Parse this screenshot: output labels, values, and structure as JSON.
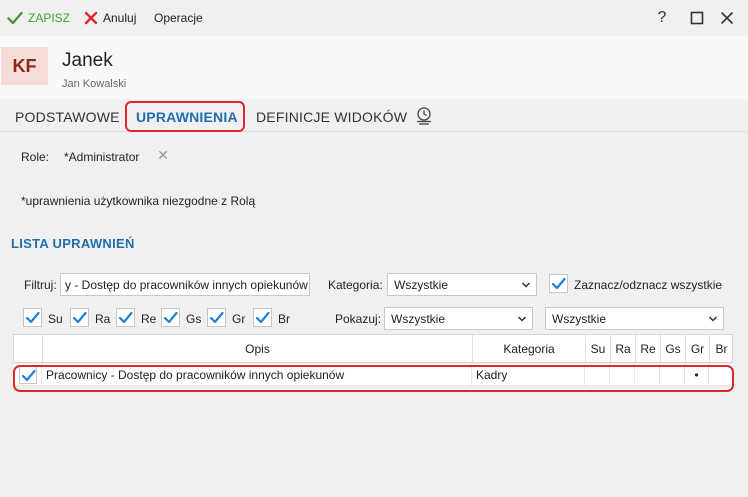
{
  "toolbar": {
    "save_label": "ZAPISZ",
    "cancel_label": "Anuluj",
    "operations_label": "Operacje",
    "help_glyph": "?",
    "save_icon": "checkmark-icon",
    "cancel_icon": "x-icon",
    "colors": {
      "save": "#4a9a3a",
      "cancel": "#e0262a"
    }
  },
  "header": {
    "avatar_initials": "KF",
    "name": "Janek",
    "subname": "Jan Kowalski"
  },
  "tabs": [
    {
      "label": "PODSTAWOWE",
      "active": false
    },
    {
      "label": "UPRAWNIENIA",
      "active": true
    },
    {
      "label": "DEFINICJE WIDOKÓW",
      "active": false
    }
  ],
  "roles": {
    "label": "Role:",
    "value": "*Administrator",
    "remove_glyph": "✕"
  },
  "note": "*uprawnienia użytkownika niezgodne z Rolą",
  "section_title": "LISTA UPRAWNIEŃ",
  "filters": {
    "filter_label": "Filtruj:",
    "filter_value": "y - Dostęp do pracowników innych opiekunów",
    "category_label": "Kategoria:",
    "category_value": "Wszystkie",
    "toggle_all_label": "Zaznacz/odznacz wszystkie",
    "show_label": "Pokazuj:",
    "show_value": "Wszystkie",
    "show_value_2": "Wszystkie",
    "flags": [
      "Su",
      "Ra",
      "Re",
      "Gs",
      "Gr",
      "Br"
    ]
  },
  "grid": {
    "columns": [
      "Opis",
      "Kategoria",
      "Su",
      "Ra",
      "Re",
      "Gs",
      "Gr",
      "Br"
    ],
    "rows": [
      {
        "checked": true,
        "opis": "Pracownicy - Dostęp do pracowników innych opiekunów",
        "kategoria": "Kadry",
        "su": "",
        "ra": "",
        "re": "",
        "gs": "",
        "gr": "•",
        "br": ""
      }
    ]
  },
  "colors": {
    "accent": "#1f6fae",
    "highlight": "#e0262a",
    "avatar_bg": "#f5dcd6",
    "avatar_fg": "#8a2b1a",
    "check": "#1f7fd6"
  }
}
